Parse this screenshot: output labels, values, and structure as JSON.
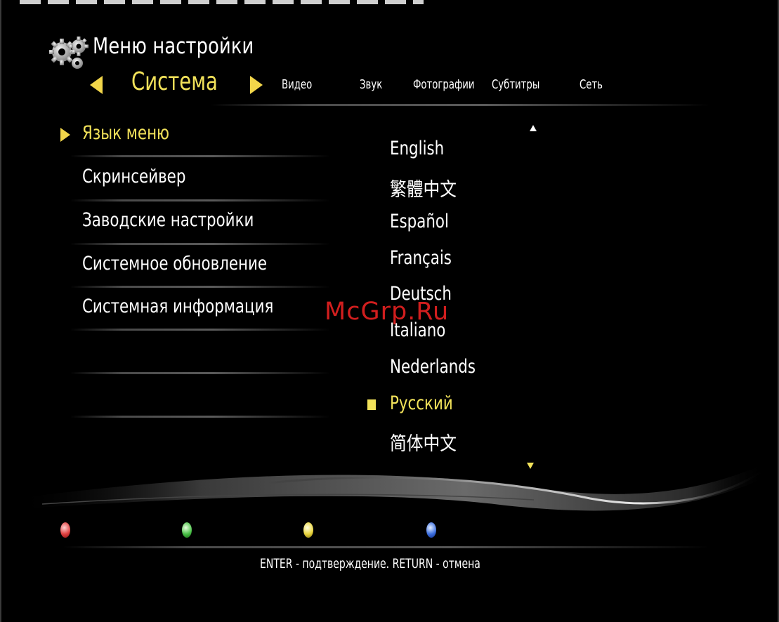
{
  "header": {
    "title": "Меню настройки",
    "icon": "gear-icon"
  },
  "tabs": {
    "active": "Система",
    "items": [
      "Видео",
      "Звук",
      "Фотографии",
      "Субтитры",
      "Сеть"
    ]
  },
  "menu": {
    "items": [
      "Язык меню",
      "Скринсейвер",
      "Заводские настройки",
      "Системное обновление",
      "Системная информация"
    ],
    "active_index": 0
  },
  "languages": {
    "items": [
      "English",
      "繁體中文",
      "Español",
      "Français",
      "Deutsch",
      "Italiano",
      "Nederlands",
      "Русский",
      "简体中文"
    ],
    "selected": "Русский"
  },
  "watermark": "McGrp.Ru",
  "footer": {
    "hint": "ENTER - подтверждение. RETURN - отмена"
  },
  "colors": {
    "accent": "#f2e25a",
    "background": "#000000",
    "watermark": "#d11e1e",
    "buttons": [
      "#e04040",
      "#49c046",
      "#e9d43c",
      "#3c6fe0"
    ]
  }
}
